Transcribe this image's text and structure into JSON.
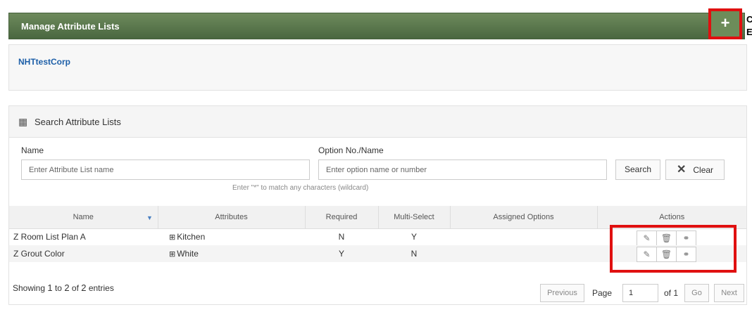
{
  "header": {
    "title": "Manage Attribute Lists",
    "add_glyph": "+",
    "edge_glyphs": [
      "C",
      "E"
    ]
  },
  "company": {
    "name": "NHTtestCorp"
  },
  "search": {
    "title": "Search Attribute Lists",
    "icon": "list-panel-icon",
    "name_label": "Name",
    "name_placeholder": "Enter Attribute List name",
    "option_label": "Option No./Name",
    "option_placeholder": "Enter option name or number",
    "hint": "Enter \"*\" to match any characters (wildcard)",
    "search_button": "Search",
    "clear_glyph": "✕",
    "clear_button": "Clear"
  },
  "table": {
    "columns": [
      "Name",
      "Attributes",
      "Required",
      "Multi-Select",
      "Assigned Options",
      "Actions"
    ],
    "sort_glyph": "▼",
    "plus_glyph": "⊞",
    "rows": [
      {
        "name": "Z Room List Plan A",
        "attribute": "Kitchen",
        "required": "N",
        "multi_select": "Y",
        "assigned_options": ""
      },
      {
        "name": "Z Grout Color",
        "attribute": "White",
        "required": "Y",
        "multi_select": "N",
        "assigned_options": ""
      }
    ],
    "action_icons": {
      "edit": "✎",
      "delete": "🗑",
      "link": "⚭"
    }
  },
  "pagination": {
    "showing_prefix": "Showing",
    "from": "1",
    "to_word": "to",
    "to": "2",
    "of_word": "of",
    "total": "2",
    "entries_word": "entries",
    "previous": "Previous",
    "page_label": "Page",
    "page_value": "1",
    "of_pages": "of 1",
    "go": "Go",
    "next": "Next"
  },
  "colors": {
    "header_green": "#4a6740",
    "highlight_red": "#e01010",
    "link_blue": "#1d5fa8"
  }
}
